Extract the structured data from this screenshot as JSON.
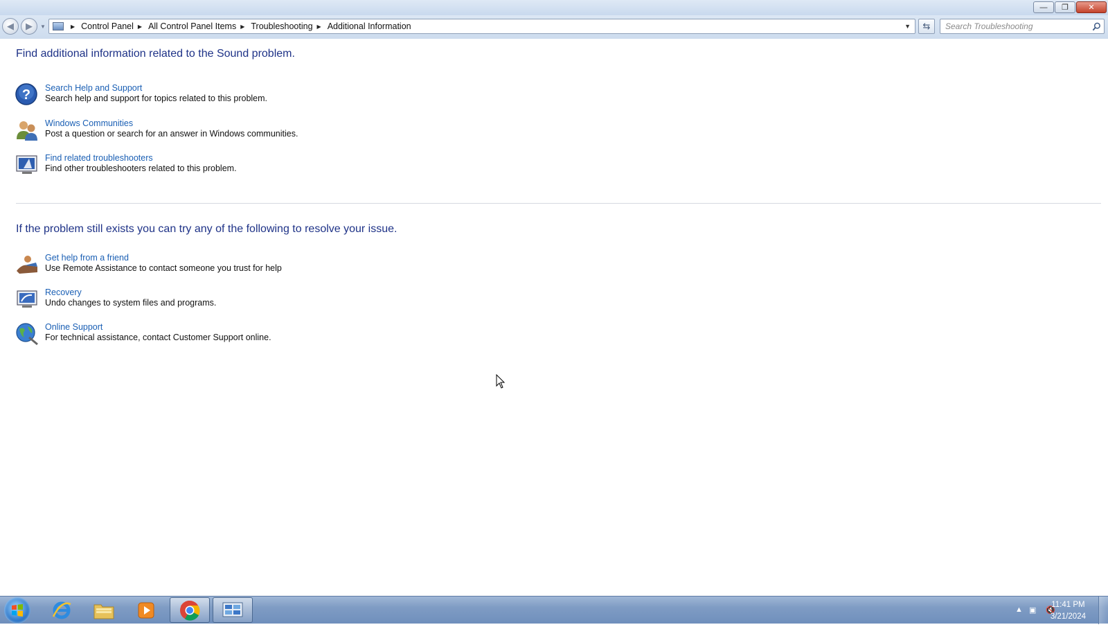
{
  "window": {
    "minimize_label": "—",
    "restore_label": "❐",
    "close_label": "✕"
  },
  "nav": {
    "back_label": "◀",
    "forward_label": "▶",
    "breadcrumbs": [
      "Control Panel",
      "All Control Panel Items",
      "Troubleshooting",
      "Additional Information"
    ],
    "search_placeholder": "Search Troubleshooting"
  },
  "content": {
    "heading1": "Find additional information related to the Sound problem.",
    "items1": [
      {
        "title": "Search Help and Support",
        "desc": "Search help and support for topics related to this problem.",
        "icon": "help-icon"
      },
      {
        "title": "Windows Communities",
        "desc": "Post a question or search for an answer in Windows communities.",
        "icon": "people-icon"
      },
      {
        "title": "Find related troubleshooters",
        "desc": "Find other troubleshooters related to this problem.",
        "icon": "troubleshooter-icon"
      }
    ],
    "heading2": "If the problem still exists you can try any of the following to resolve your issue.",
    "items2": [
      {
        "title": "Get help from a friend",
        "desc": "Use Remote Assistance to contact someone you trust for help",
        "icon": "remote-assistance-icon"
      },
      {
        "title": "Recovery",
        "desc": "Undo changes to system files and programs.",
        "icon": "recovery-icon"
      },
      {
        "title": "Online Support",
        "desc": "For technical assistance, contact Customer Support online.",
        "icon": "globe-icon"
      }
    ]
  },
  "taskbar": {
    "apps": [
      "internet-explorer-icon",
      "file-explorer-icon",
      "media-player-icon",
      "chrome-icon",
      "control-panel-icon"
    ],
    "clock_time": "11:41 PM",
    "clock_date": "3/21/2024"
  },
  "colors": {
    "heading": "#1e3287",
    "link": "#1a5fb4",
    "taskbar": "#7f9cc4"
  }
}
